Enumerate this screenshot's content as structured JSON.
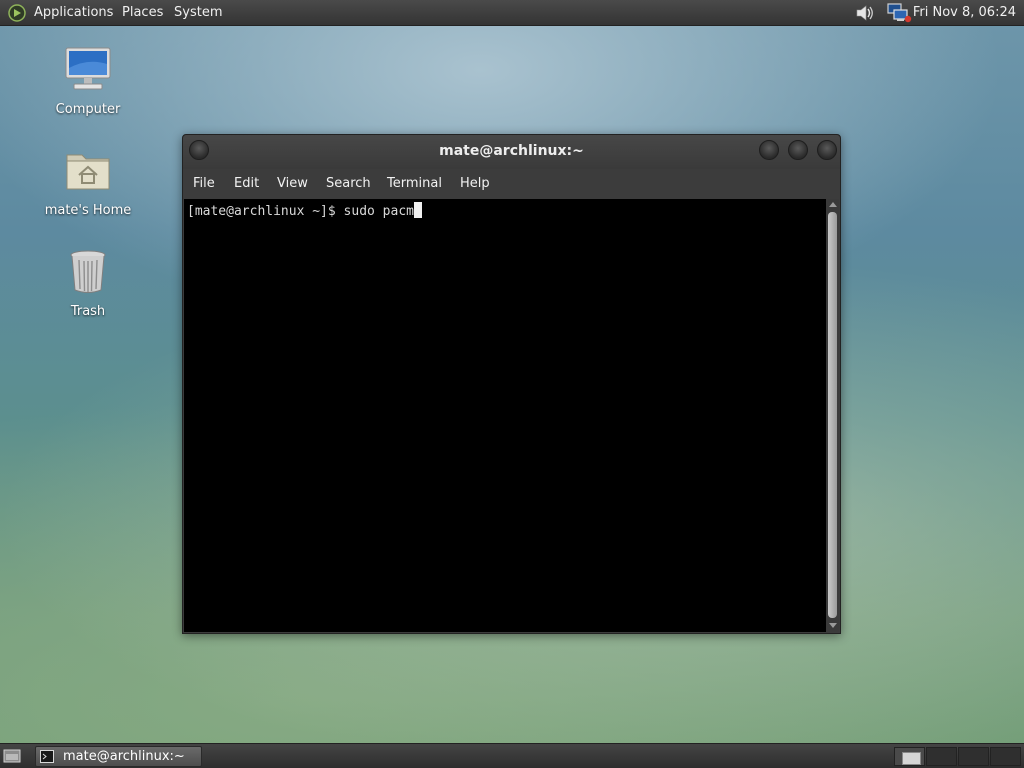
{
  "top_panel": {
    "menus": [
      "Applications",
      "Places",
      "System"
    ],
    "clock": "Fri Nov  8, 06:24",
    "tray_icons": [
      "volume-icon",
      "network-icon"
    ],
    "menu_logo_icon": "mate-logo-icon"
  },
  "desktop": {
    "icons": [
      {
        "label": "Computer",
        "icon": "computer-monitor-icon"
      },
      {
        "label": "mate's Home",
        "icon": "home-folder-icon"
      },
      {
        "label": "Trash",
        "icon": "trash-icon"
      }
    ]
  },
  "terminal_window": {
    "title": "mate@archlinux:~",
    "menu": [
      "File",
      "Edit",
      "View",
      "Search",
      "Terminal",
      "Help"
    ],
    "prompt": "[mate@archlinux ~]$ ",
    "typed_command": "sudo pacm",
    "colors": {
      "background": "#000000",
      "text": "#d8d8d8"
    }
  },
  "bottom_panel": {
    "taskbar_items": [
      {
        "label": "mate@archlinux:~",
        "icon": "terminal-icon"
      }
    ],
    "show_desktop_icon": "show-desktop-icon",
    "workspaces": 4
  }
}
